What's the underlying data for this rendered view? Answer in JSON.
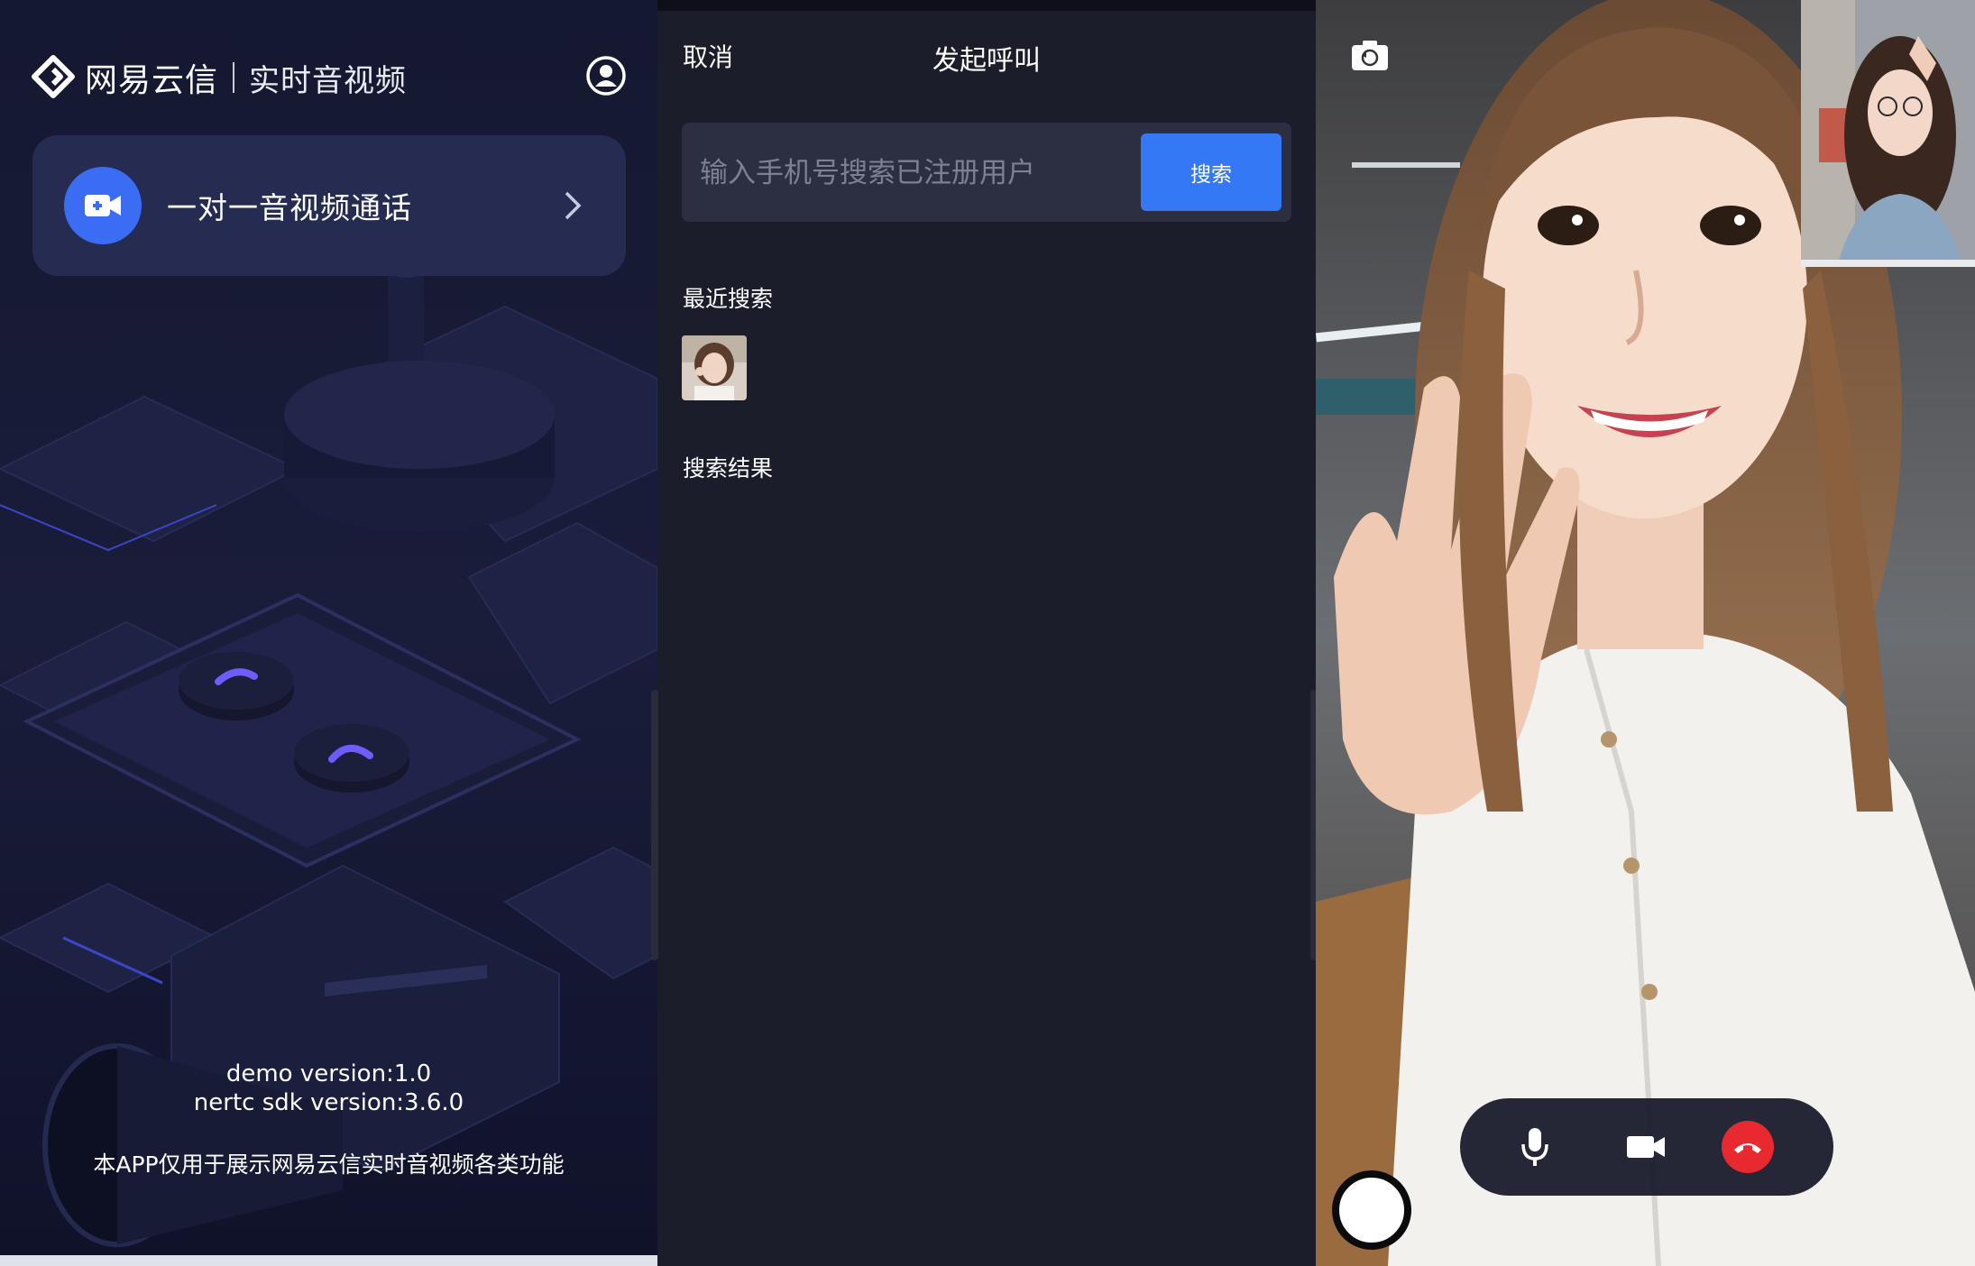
{
  "home": {
    "brand_name": "网易云信",
    "product_name": "实时音视频",
    "card_label": "一对一音视频通话",
    "demo_version": "demo version:1.0",
    "sdk_version": "nertc sdk version:3.6.0",
    "disclaimer": "本APP仅用于展示网易云信实时音视频各类功能",
    "icons": [
      "brand-logo-icon",
      "profile-icon",
      "video-camera-icon",
      "chevron-right-icon"
    ]
  },
  "search": {
    "cancel_label": "取消",
    "title": "发起呼叫",
    "input_placeholder": "输入手机号搜索已注册用户",
    "button_label": "搜索",
    "recent_label": "最近搜索",
    "results_label": "搜索结果"
  },
  "call": {
    "icons": [
      "flip-camera-icon",
      "microphone-icon",
      "video-camera-icon",
      "hangup-icon"
    ],
    "colors": {
      "hangup": "#e8292f",
      "accent": "#3478f6"
    }
  }
}
